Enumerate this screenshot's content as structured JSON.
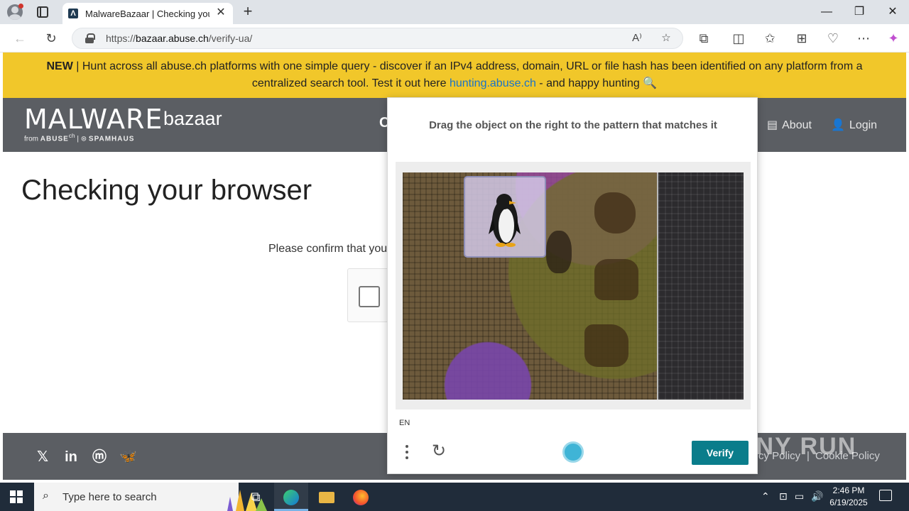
{
  "browser": {
    "tab_title": "MalwareBazaar | Checking your browser",
    "tab_favicon": "Λ",
    "url_prefix": "https://",
    "url_domain": "bazaar.abuse.ch",
    "url_path": "/verify-ua/"
  },
  "banner": {
    "new_label": "NEW",
    "text_before": " | Hunt across all abuse.ch platforms with one simple query - discover if an IPv4 address, domain, URL or file hash has been identified on any platform from a centralized search tool. Test it out here ",
    "link_text": "hunting.abuse.ch",
    "text_after": " - and happy hunting 🔍",
    "link_color": "#1a73c8",
    "background_color": "#f1c72a"
  },
  "navbar": {
    "logo_main": "MALWARE",
    "logo_sub": "bazaar",
    "logo_from": "from",
    "logo_abuse": "ABUSE",
    "logo_ch": "ch",
    "logo_spamhaus": "SPAMHAUS",
    "cut_item": "C",
    "about": "About",
    "login": "Login"
  },
  "page": {
    "heading": "Checking your browser",
    "confirm_text": "Please confirm that you"
  },
  "captcha": {
    "prompt": "Drag the object on the right to the pattern that matches it",
    "language": "EN",
    "verify_label": "Verify",
    "verify_color": "#0a7d8b"
  },
  "footer": {
    "links": [
      "cy Policy",
      "|",
      "Cookie Policy"
    ]
  },
  "watermark": "ANY RUN",
  "taskbar": {
    "search_placeholder": "Type here to search",
    "time": "2:46 PM",
    "date": "6/19/2025"
  }
}
